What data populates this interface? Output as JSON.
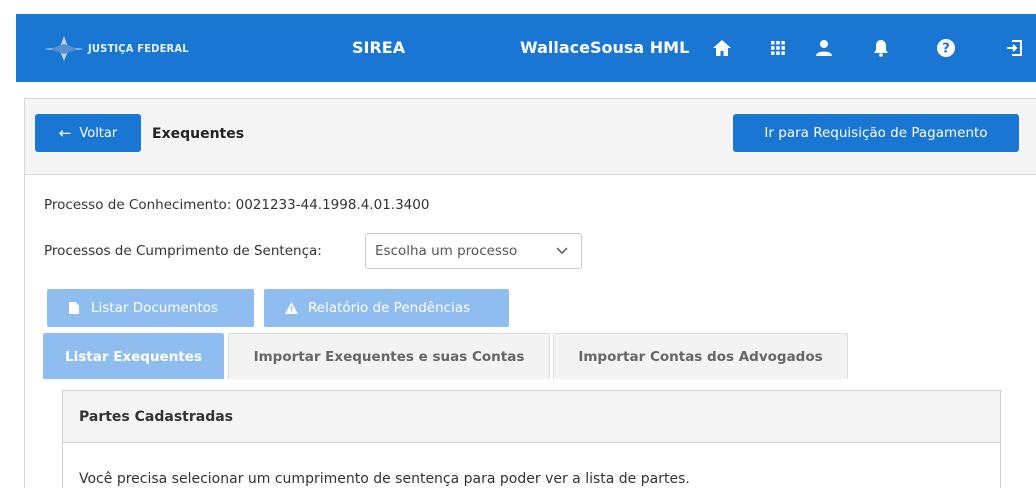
{
  "header": {
    "logo_text": "JUSTIÇA FEDERAL",
    "app_name": "SIREA",
    "user_name": "WallaceSousa HML",
    "icons": [
      "home-icon",
      "apps-grid-icon",
      "user-icon",
      "bell-icon",
      "help-icon",
      "logout-icon"
    ],
    "bg_color": "#1976d2"
  },
  "page": {
    "back_label": "Voltar",
    "title": "Exequentes",
    "goto_label": "Ir para Requisição de Pagamento"
  },
  "process": {
    "knowledge_label": "Processo de Conhecimento: 0021233-44.1998.4.01.3400",
    "sentence_label": "Processos de Cumprimento de Sentença:",
    "select_placeholder": "Escolha um processo"
  },
  "actions": {
    "list_docs": "Listar Documentos",
    "pending_report": "Relatório de Pendências"
  },
  "tabs": [
    {
      "label": "Listar Exequentes",
      "active": true
    },
    {
      "label": "Importar Exequentes e suas Contas",
      "active": false
    },
    {
      "label": "Importar Contas dos Advogados",
      "active": false
    }
  ],
  "card": {
    "title": "Partes Cadastradas",
    "message": "Você precisa selecionar um cumprimento de sentença para poder ver a lista de partes."
  }
}
